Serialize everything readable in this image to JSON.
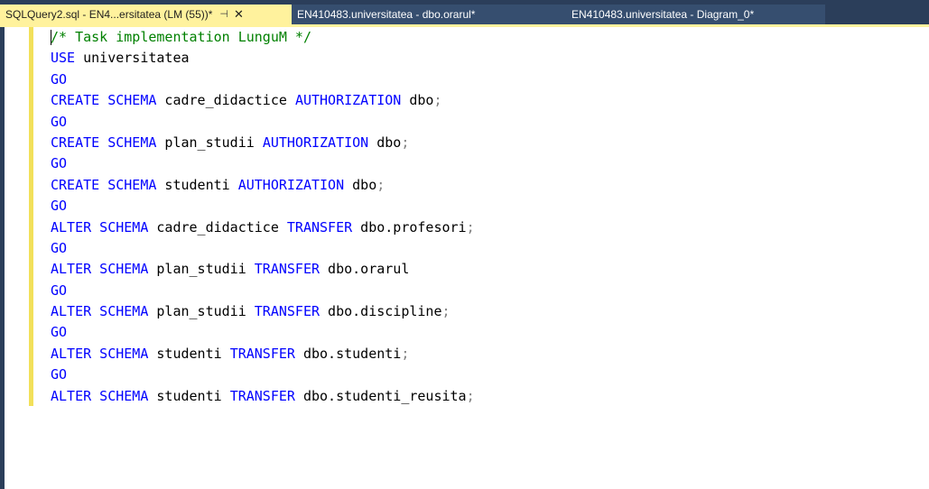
{
  "tabs": [
    {
      "label": "SQLQuery2.sql - EN4...ersitatea (LM (55))*",
      "pin_icon": "⊣",
      "close_icon": "✕",
      "active": true
    },
    {
      "label": "EN410483.universitatea - dbo.orarul*",
      "active": false
    },
    {
      "label": "EN410483.universitatea - Diagram_0*",
      "active": false
    }
  ],
  "colors": {
    "tab_bar": "#2b3e5a",
    "active_tab": "#fff29d",
    "keyword": "#0000ff",
    "comment": "#008000",
    "change_bar": "#f2e05a"
  },
  "code": {
    "l1": "/* Task implementation LunguM */",
    "l2_kw": "USE",
    "l2_id": " universitatea",
    "go": "GO",
    "create": "CREATE SCHEMA",
    "alter": "ALTER SCHEMA",
    "authorization": "AUTHORIZATION",
    "transfer": "TRANSFER",
    "dbo": "dbo",
    "s_cadre": " cadre_didactice ",
    "s_plan": " plan_studii ",
    "s_studenti": " studenti ",
    "t_profesori": " dbo.profesori",
    "t_orarul": " dbo.orarul",
    "t_discipline": " dbo.discipline",
    "t_studenti": " dbo.studenti",
    "t_studenti_reusita": " dbo.studenti_reusita",
    "semicolon": ";"
  }
}
